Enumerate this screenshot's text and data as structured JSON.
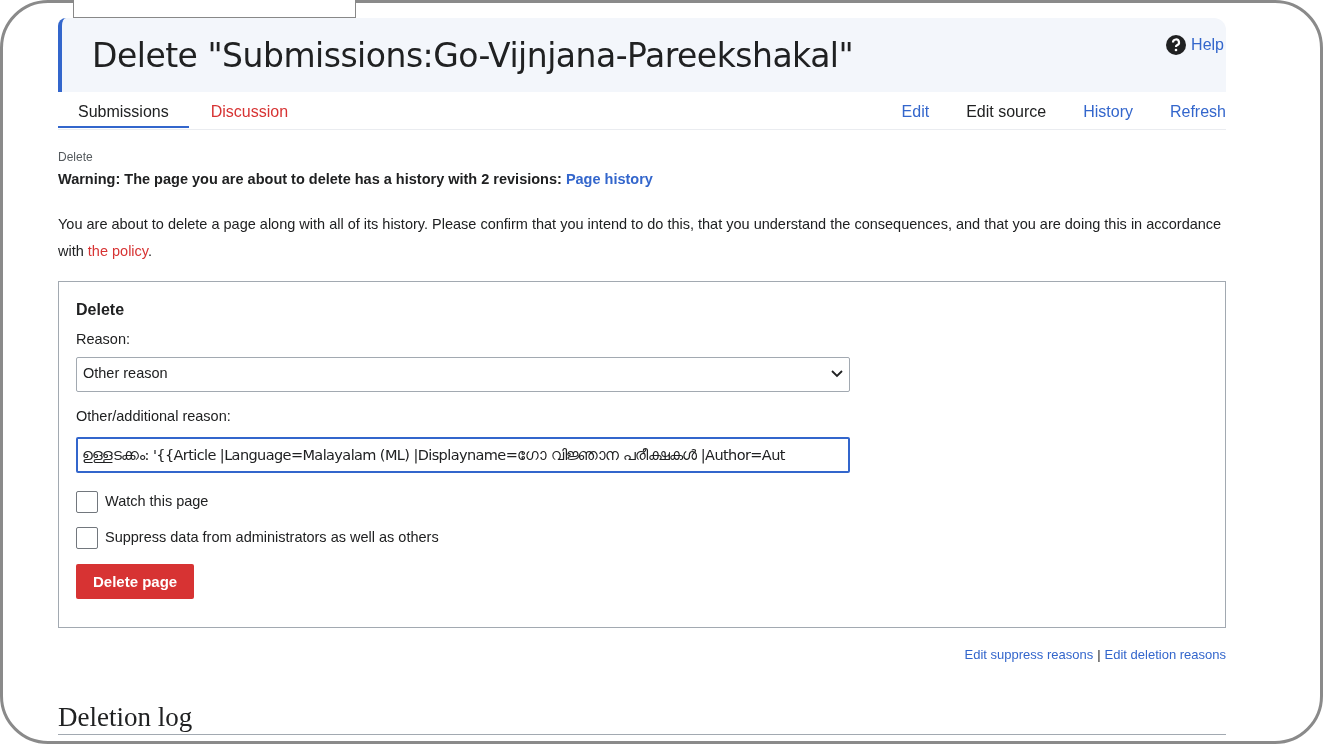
{
  "title": "Delete \"Submissions:Go-Vijnjana-Pareekshakal\"",
  "help": "Help",
  "tabs": [
    {
      "label": "Submissions",
      "selected": true,
      "kind": "page"
    },
    {
      "label": "Discussion",
      "selected": false,
      "kind": "missing"
    }
  ],
  "actions": [
    "Edit",
    "Edit source",
    "History",
    "Refresh"
  ],
  "subtitle": "Delete",
  "warning": {
    "text": "Warning: The page you are about to delete has a history with 2 revisions:",
    "link": "Page history"
  },
  "intro": {
    "text": "You are about to delete a page along with all of its history. Please confirm that you intend to do this, that you understand the consequences, and that you are doing this in accordance with",
    "link": "the policy",
    "end": "."
  },
  "form": {
    "legend": "Delete",
    "reason_label": "Reason:",
    "reason_value": "Other reason",
    "other_label": "Other/additional reason:",
    "other_value": "ഉള്ളടക്കം: '{{Article |Language=Malayalam (ML) |Displayname=ഗോ വിജ്ഞാന പരീക്ഷകൾ |Author=Aut",
    "checkboxes": [
      {
        "label": "Watch this page",
        "checked": false
      },
      {
        "label": "Suppress data from administrators as well as others",
        "checked": false
      }
    ],
    "submit": "Delete page"
  },
  "footer_links": [
    "Edit suppress reasons",
    "Edit deletion reasons"
  ],
  "footer_separator": "|",
  "section_heading": "Deletion log"
}
